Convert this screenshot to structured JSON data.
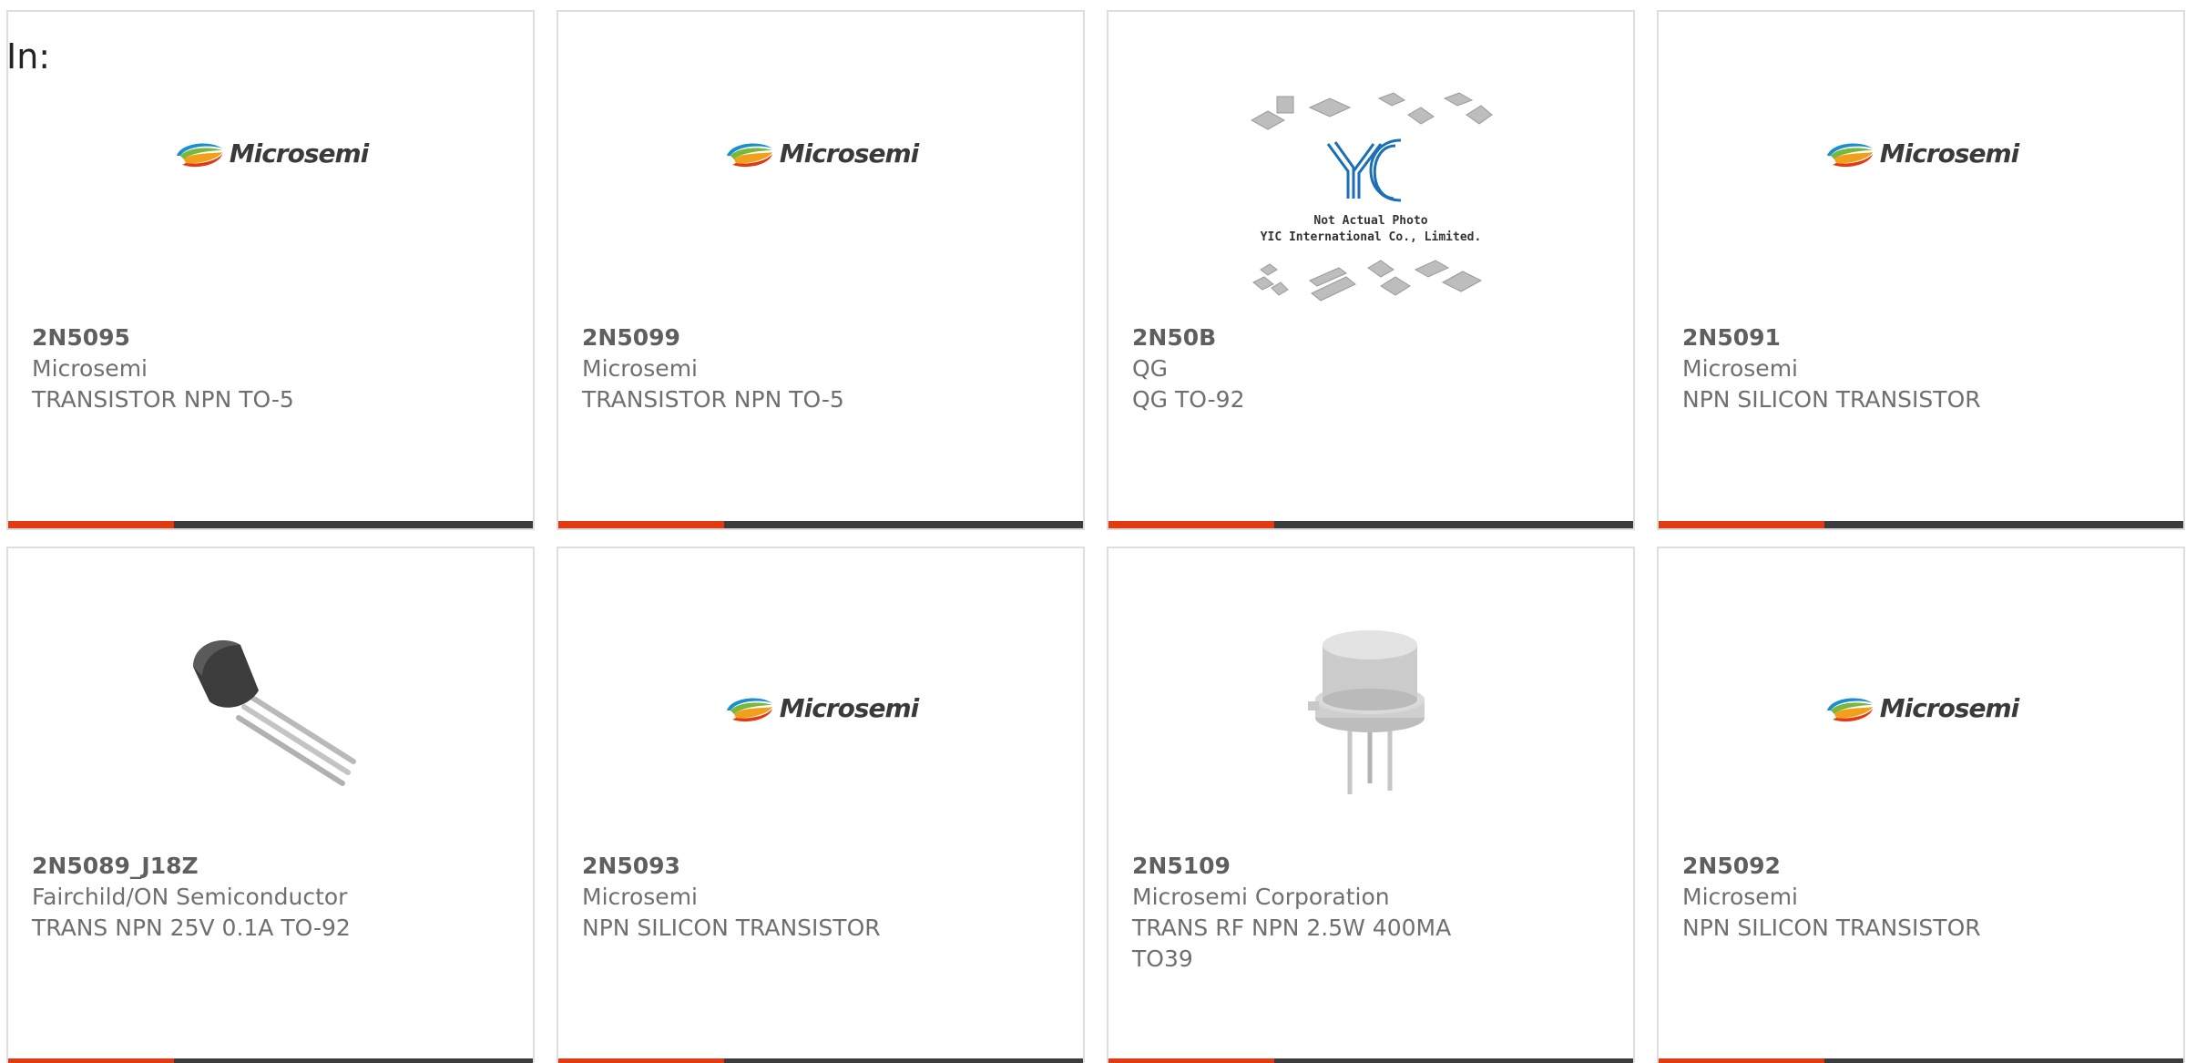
{
  "header": {
    "in_label": "In:"
  },
  "products": [
    {
      "part": "2N5095",
      "manufacturer": "Microsemi",
      "description": "TRANSISTOR NPN TO-5",
      "image": "microsemi-logo"
    },
    {
      "part": "2N5099",
      "manufacturer": "Microsemi",
      "description": "TRANSISTOR NPN TO-5",
      "image": "microsemi-logo"
    },
    {
      "part": "2N50B",
      "manufacturer": "QG",
      "description": "QG TO-92",
      "image": "yic-placeholder",
      "image_text": {
        "logo": "YIC",
        "line1": "Not Actual Photo",
        "line2": "YIC International Co., Limited."
      }
    },
    {
      "part": "2N5091",
      "manufacturer": "Microsemi",
      "description": "NPN SILICON TRANSISTOR",
      "image": "microsemi-logo"
    },
    {
      "part": "2N5089_J18Z",
      "manufacturer": "Fairchild/ON Semiconductor",
      "description": "TRANS NPN 25V 0.1A TO-92",
      "image": "to92-transistor"
    },
    {
      "part": "2N5093",
      "manufacturer": "Microsemi",
      "description": "NPN SILICON TRANSISTOR",
      "image": "microsemi-logo"
    },
    {
      "part": "2N5109",
      "manufacturer": "Microsemi Corporation",
      "description": "TRANS RF NPN 2.5W 400MA TO39",
      "image": "to39-transistor"
    },
    {
      "part": "2N5092",
      "manufacturer": "Microsemi",
      "description": "NPN SILICON TRANSISTOR",
      "image": "microsemi-logo"
    }
  ],
  "logo_text": "Microsemi",
  "colors": {
    "accent": "#e23b12",
    "bar": "#3a3c3e",
    "border": "#dedede",
    "text": "#6f6f6f"
  }
}
